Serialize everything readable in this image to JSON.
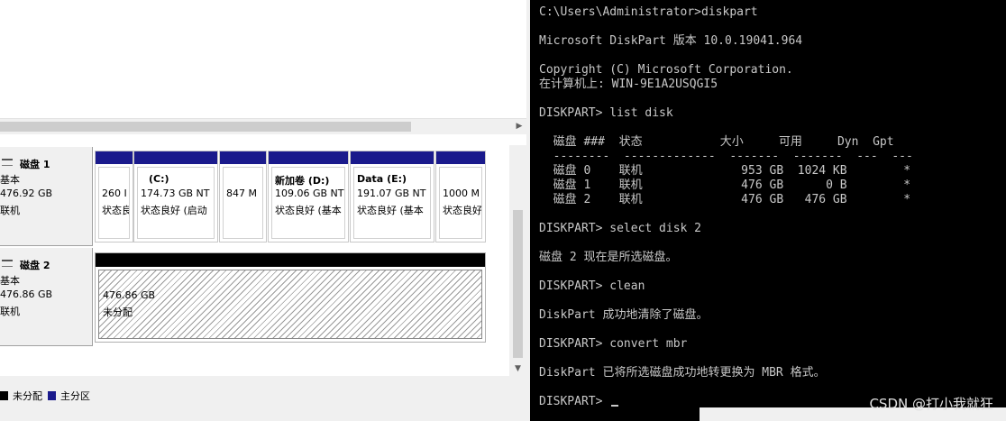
{
  "disk_management": {
    "disks": [
      {
        "name": "磁盘 1",
        "type": "基本",
        "size": "476.92 GB",
        "status": "联机",
        "partitions": [
          {
            "label": "",
            "size": "260 I",
            "status": "状态良好"
          },
          {
            "label": "(C:)",
            "size": "174.73 GB NT",
            "status": "状态良好 (启动"
          },
          {
            "label": "",
            "size": "847 M",
            "status": ""
          },
          {
            "label": "新加卷 (D:)",
            "size": "109.06 GB NT",
            "status": "状态良好 (基本"
          },
          {
            "label": "Data (E:)",
            "size": "191.07 GB NT",
            "status": "状态良好 (基本"
          },
          {
            "label": "",
            "size": "1000 M",
            "status": "状态良好"
          }
        ]
      },
      {
        "name": "磁盘 2",
        "type": "基本",
        "size": "476.86 GB",
        "status": "联机",
        "unallocated_size": "476.86 GB",
        "unallocated_label": "未分配"
      }
    ],
    "legend": [
      {
        "label": "未分配",
        "color": "#000000"
      },
      {
        "label": "主分区",
        "color": "#1a1a8c"
      }
    ]
  },
  "console": {
    "lines": [
      "C:\\Users\\Administrator>diskpart",
      "",
      "Microsoft DiskPart 版本 10.0.19041.964",
      "",
      "Copyright (C) Microsoft Corporation.",
      "在计算机上: WIN-9E1A2USQGI5",
      "",
      "DISKPART> list disk",
      "",
      "  磁盘 ###  状态           大小     可用     Dyn  Gpt",
      "  --------  -------------  -------  -------  ---  ---",
      "  磁盘 0    联机              953 GB  1024 KB        *",
      "  磁盘 1    联机              476 GB      0 B        *",
      "  磁盘 2    联机              476 GB   476 GB        *",
      "",
      "DISKPART> select disk 2",
      "",
      "磁盘 2 现在是所选磁盘。",
      "",
      "DISKPART> clean",
      "",
      "DiskPart 成功地清除了磁盘。",
      "",
      "DISKPART> convert mbr",
      "",
      "DiskPart 已将所选磁盘成功地转更换为 MBR 格式。",
      "",
      "DISKPART> "
    ],
    "watermark": "CSDN @打小我就狂"
  }
}
